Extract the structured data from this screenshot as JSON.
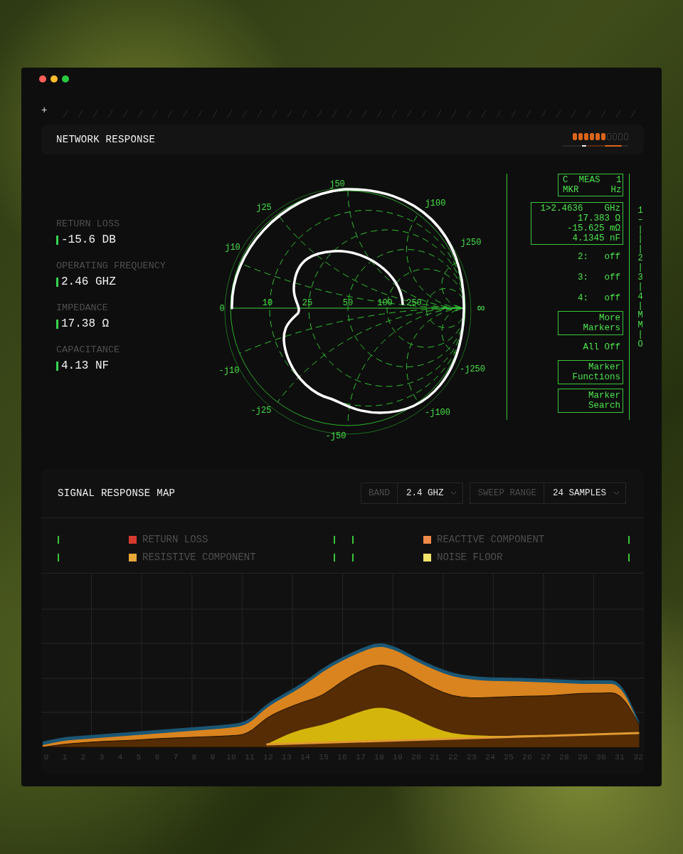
{
  "window": {
    "controls": [
      {
        "color": "#ff5f57"
      },
      {
        "color": "#febc2e"
      },
      {
        "color": "#28c840"
      }
    ],
    "corner_mark": "+"
  },
  "network_panel": {
    "title": "NETWORK RESPONSE",
    "signal_meter": {
      "level": 0.6
    },
    "metrics": [
      {
        "label": "RETURN LOSS",
        "value": "-15.6 DB"
      },
      {
        "label": "OPERATING FREQUENCY",
        "value": "2.46 GHZ"
      },
      {
        "label": "IMPEDANCE",
        "value": "17.38 Ω"
      },
      {
        "label": "CAPACITANCE",
        "value": "4.13 NF"
      }
    ],
    "smith_chart": {
      "labels": [
        "j50",
        "j25",
        "j100",
        "j10",
        "j250",
        "0",
        "10",
        "25",
        "50",
        "100",
        "250",
        "∞",
        "-j10",
        "-j250",
        "-j25",
        "-j100",
        "-j50"
      ]
    },
    "marker_panel": {
      "header": [
        "C  MEAS   1",
        "MKR      Hz"
      ],
      "readout": [
        "1>2.4636    GHz",
        "17.383 Ω",
        "-15.625 mΩ",
        "4.1345 nF"
      ],
      "entries": [
        {
          "kind": "status",
          "lines": [
            "2:   off"
          ]
        },
        {
          "kind": "status",
          "lines": [
            "3:   off"
          ]
        },
        {
          "kind": "status",
          "lines": [
            "4:   off"
          ]
        },
        {
          "kind": "button",
          "lines": [
            "More",
            "Markers"
          ]
        },
        {
          "kind": "status",
          "lines": [
            "All Off"
          ]
        },
        {
          "kind": "button",
          "lines": [
            "Marker",
            "Functions"
          ]
        },
        {
          "kind": "button",
          "lines": [
            "Marker",
            "Search"
          ]
        }
      ],
      "scale": [
        "1",
        "–",
        "|",
        "|",
        "|",
        "2",
        "|",
        "3",
        "|",
        "4",
        "|",
        "M",
        "M",
        "|",
        "O"
      ]
    }
  },
  "signal_map": {
    "title": "SIGNAL RESPONSE MAP",
    "selects": [
      {
        "label": "BAND",
        "value": "2.4 GHZ"
      },
      {
        "label": "SWEEP RANGE",
        "value": "24 SAMPLES"
      }
    ],
    "legend": [
      {
        "label": "RETURN LOSS",
        "color": "#d63a2f"
      },
      {
        "label": "REACTIVE COMPONENT",
        "color": "#f08a4b"
      },
      {
        "label": "RESISTIVE COMPONENT",
        "color": "#e8a838"
      },
      {
        "label": "NOISE FLOOR",
        "color": "#f3e36a"
      }
    ],
    "x_axis_labels": [
      "0",
      "1",
      "2",
      "3",
      "4",
      "5",
      "6",
      "7",
      "8",
      "9",
      "10",
      "11",
      "12",
      "13",
      "14",
      "15",
      "16",
      "17",
      "18",
      "19",
      "20",
      "21",
      "22",
      "23",
      "24",
      "25",
      "26",
      "27",
      "28",
      "29",
      "30",
      "31",
      "32"
    ]
  }
}
